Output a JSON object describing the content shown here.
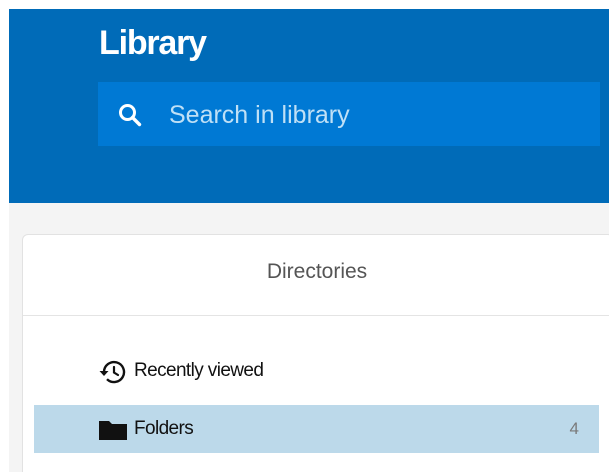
{
  "header": {
    "title": "Library",
    "background_color": "#006bb8",
    "search": {
      "placeholder": "Search in library",
      "value": "",
      "icon": "search-icon"
    }
  },
  "directories": {
    "title": "Directories",
    "items": [
      {
        "label": "Recently viewed",
        "icon": "history-icon",
        "count": "",
        "selected": false
      },
      {
        "label": "Folders",
        "icon": "folder-icon",
        "count": "4",
        "selected": true
      }
    ]
  },
  "colors": {
    "accent": "#006bb8",
    "search_bg": "#0079d4",
    "selected_row": "#bcd9ea"
  }
}
